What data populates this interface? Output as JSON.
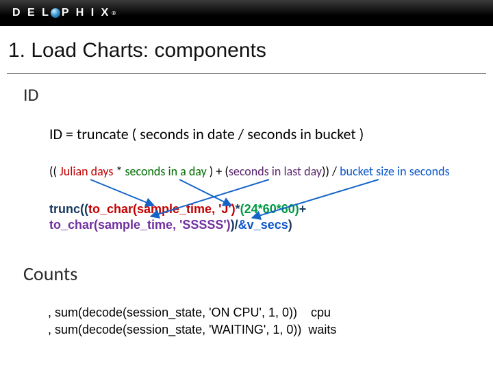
{
  "brand": {
    "name_pre": "D E L",
    "name_post": "P H I X",
    "reg": "®"
  },
  "title": "1. Load Charts: components",
  "section_id": "ID",
  "line_id": "ID =   truncate ( seconds in date / seconds in bucket )",
  "expl": {
    "open": "(( ",
    "jd": "Julian days ",
    "mul": "* ",
    "sd": "seconds in a day ",
    "mid": ") + (",
    "ld": "seconds in last day",
    "close": "))  / ",
    "bu": "bucket size in seconds"
  },
  "code": {
    "l1a": "trunc(",
    "l1b": "(",
    "l1c": "to_char(sample_time, 'J')",
    "l1d": "*",
    "l1e": "(24*60*60)",
    "l1f": "+",
    "l2a": "to_char(sample_time, 'SSSSS')",
    "l2b": ")",
    "l2c": "/",
    "l2d": "&v_secs",
    "l2e": ")"
  },
  "section_counts": "Counts",
  "counts": {
    "l1": ", sum(decode(session_state, 'ON CPU', 1, 0))    cpu",
    "l2": ", sum(decode(session_state, 'WAITING', 1, 0))  waits"
  }
}
